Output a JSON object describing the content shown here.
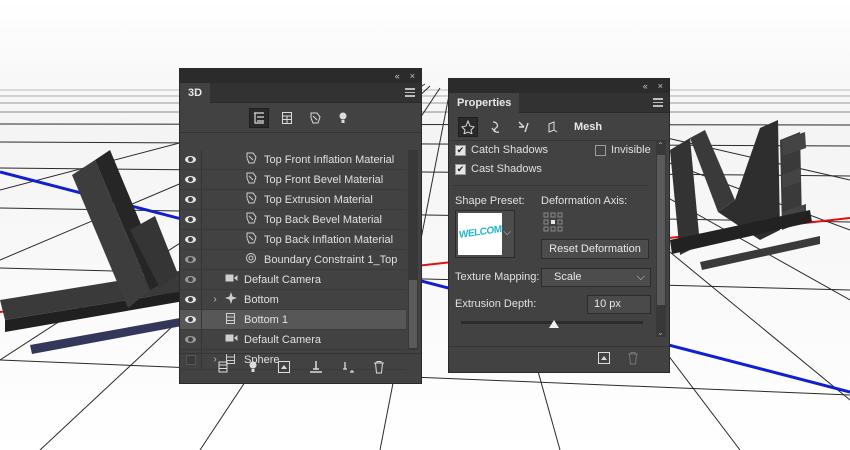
{
  "scene": {
    "title_letters_left": "W",
    "title_letters_right": "ME"
  },
  "panel_3d": {
    "tab": "3D",
    "collapse_glyph": "«",
    "close_glyph": "×",
    "filter_icons": [
      "scene-icon",
      "mesh-filter-icon",
      "material-filter-icon",
      "light-filter-icon"
    ],
    "rows": [
      {
        "label": "Top Front Inflation Material",
        "icon": "material-icon",
        "visible": true,
        "indent": 2,
        "caret": false,
        "selected": false
      },
      {
        "label": "Top Front Bevel Material",
        "icon": "material-icon",
        "visible": true,
        "indent": 2,
        "caret": false,
        "selected": false
      },
      {
        "label": "Top Extrusion Material",
        "icon": "material-icon",
        "visible": true,
        "indent": 2,
        "caret": false,
        "selected": false
      },
      {
        "label": "Top Back Bevel Material",
        "icon": "material-icon",
        "visible": true,
        "indent": 2,
        "caret": false,
        "selected": false
      },
      {
        "label": "Top Back Inflation Material",
        "icon": "material-icon",
        "visible": true,
        "indent": 2,
        "caret": false,
        "selected": false
      },
      {
        "label": "Boundary Constraint 1_Top",
        "icon": "constraint-icon",
        "visible": "dim",
        "indent": 2,
        "caret": false,
        "selected": false
      },
      {
        "label": "Default Camera",
        "icon": "camera-icon",
        "visible": "dim",
        "indent": 1,
        "caret": false,
        "selected": false
      },
      {
        "label": "Bottom",
        "icon": "light-icon",
        "visible": true,
        "indent": 1,
        "caret": true,
        "selected": false
      },
      {
        "label": "Bottom 1",
        "icon": "mesh-icon",
        "visible": true,
        "indent": 1,
        "caret": false,
        "selected": true
      },
      {
        "label": "Default Camera",
        "icon": "camera-icon",
        "visible": "dim",
        "indent": 1,
        "caret": false,
        "selected": false
      },
      {
        "label": "Sphere",
        "icon": "mesh-icon",
        "visible": false,
        "indent": 1,
        "caret": true,
        "selected": false
      }
    ],
    "bottom_icons": [
      "new-mesh-icon",
      "new-light-icon",
      "render-icon",
      "ground-icon",
      "delete-icon"
    ]
  },
  "panel_properties": {
    "tab": "Properties",
    "mode_icons": [
      "mesh-mode-icon",
      "deform-mode-icon",
      "cap-mode-icon",
      "coordinates-mode-icon"
    ],
    "mode_label": "Mesh",
    "catch_shadows": "Catch Shadows",
    "invisible": "Invisible",
    "cast_shadows": "Cast Shadows",
    "shape_preset_label": "Shape Preset:",
    "shape_preset_preview": "WELCOM",
    "deformation_axis_label": "Deformation Axis:",
    "reset_deformation": "Reset Deformation",
    "texture_mapping_label": "Texture Mapping:",
    "texture_mapping_value": "Scale",
    "extrusion_depth_label": "Extrusion Depth:",
    "extrusion_depth_value": "10 px",
    "extrusion_slider_fraction": 0.51,
    "bottom_icons": [
      "render-icon",
      "delete-icon"
    ]
  },
  "colors": {
    "panel_bg": "#424242",
    "selected_row": "#575757",
    "axis_red": "#e01010",
    "axis_blue": "#1020d0",
    "preset_cyan": "#20b8c8"
  }
}
